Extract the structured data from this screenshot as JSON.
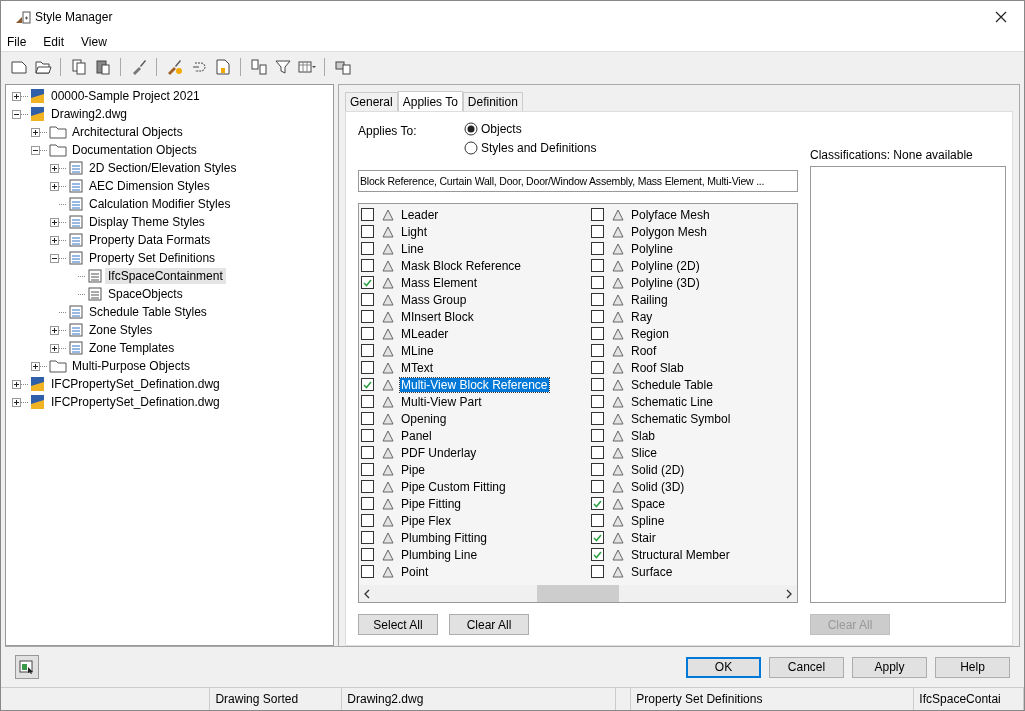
{
  "window": {
    "title": "Style Manager"
  },
  "menu": [
    "File",
    "Edit",
    "View"
  ],
  "tree": [
    {
      "label": "00000-Sample Project 2021",
      "expanded": false,
      "selected": false
    },
    {
      "label": "Drawing2.dwg",
      "expanded": true,
      "selected": false,
      "children": [
        {
          "label": "Architectural Objects",
          "expanded": false,
          "selected": false
        },
        {
          "label": "Documentation Objects",
          "expanded": true,
          "selected": false,
          "children": [
            {
              "label": "2D Section/Elevation Styles",
              "expanded": false,
              "selected": false
            },
            {
              "label": "AEC Dimension Styles",
              "expanded": false,
              "selected": false
            },
            {
              "label": "Calculation Modifier Styles",
              "selected": false
            },
            {
              "label": "Display Theme Styles",
              "expanded": false,
              "selected": false
            },
            {
              "label": "Property Data Formats",
              "expanded": false,
              "selected": false
            },
            {
              "label": "Property Set Definitions",
              "expanded": true,
              "selected": false,
              "children": [
                {
                  "label": "IfcSpaceContainment",
                  "selected": true
                },
                {
                  "label": "SpaceObjects",
                  "selected": false
                }
              ]
            },
            {
              "label": "Schedule Table Styles",
              "selected": false
            },
            {
              "label": "Zone Styles",
              "expanded": false,
              "selected": false
            },
            {
              "label": "Zone Templates",
              "expanded": false,
              "selected": false
            }
          ]
        },
        {
          "label": "Multi-Purpose Objects",
          "expanded": false,
          "selected": false
        }
      ]
    },
    {
      "label": "IFCPropertySet_Defination.dwg",
      "expanded": false,
      "selected": false
    },
    {
      "label": "IFCPropertySet_Defination.dwg",
      "expanded": false,
      "selected": false
    }
  ],
  "tabs": [
    {
      "label": "General",
      "selected": false
    },
    {
      "label": "Applies To",
      "selected": true
    },
    {
      "label": "Definition",
      "selected": false
    }
  ],
  "applies_to": {
    "label": "Applies To:",
    "options": [
      {
        "label": "Objects",
        "selected": true
      },
      {
        "label": "Styles and Definitions",
        "selected": false
      }
    ],
    "summary": "Block Reference, Curtain Wall, Door, Door/Window Assembly, Mass Element, Multi-View ...",
    "items": [
      {
        "label": "Leader",
        "checked": false,
        "selected": false
      },
      {
        "label": "Light",
        "checked": false,
        "selected": false
      },
      {
        "label": "Line",
        "checked": false,
        "selected": false
      },
      {
        "label": "Mask Block Reference",
        "checked": false,
        "selected": false
      },
      {
        "label": "Mass Element",
        "checked": true,
        "selected": false
      },
      {
        "label": "Mass Group",
        "checked": false,
        "selected": false
      },
      {
        "label": "MInsert Block",
        "checked": false,
        "selected": false
      },
      {
        "label": "MLeader",
        "checked": false,
        "selected": false
      },
      {
        "label": "MLine",
        "checked": false,
        "selected": false
      },
      {
        "label": "MText",
        "checked": false,
        "selected": false
      },
      {
        "label": "Multi-View Block Reference",
        "checked": true,
        "selected": true
      },
      {
        "label": "Multi-View Part",
        "checked": false,
        "selected": false
      },
      {
        "label": "Opening",
        "checked": false,
        "selected": false
      },
      {
        "label": "Panel",
        "checked": false,
        "selected": false
      },
      {
        "label": "PDF Underlay",
        "checked": false,
        "selected": false
      },
      {
        "label": "Pipe",
        "checked": false,
        "selected": false
      },
      {
        "label": "Pipe Custom Fitting",
        "checked": false,
        "selected": false
      },
      {
        "label": "Pipe Fitting",
        "checked": false,
        "selected": false
      },
      {
        "label": "Pipe Flex",
        "checked": false,
        "selected": false
      },
      {
        "label": "Plumbing Fitting",
        "checked": false,
        "selected": false
      },
      {
        "label": "Plumbing Line",
        "checked": false,
        "selected": false
      },
      {
        "label": "Point",
        "checked": false,
        "selected": false
      },
      {
        "label": "Polyface Mesh",
        "checked": false,
        "selected": false
      },
      {
        "label": "Polygon Mesh",
        "checked": false,
        "selected": false
      },
      {
        "label": "Polyline",
        "checked": false,
        "selected": false
      },
      {
        "label": "Polyline (2D)",
        "checked": false,
        "selected": false
      },
      {
        "label": "Polyline (3D)",
        "checked": false,
        "selected": false
      },
      {
        "label": "Railing",
        "checked": false,
        "selected": false
      },
      {
        "label": "Ray",
        "checked": false,
        "selected": false
      },
      {
        "label": "Region",
        "checked": false,
        "selected": false
      },
      {
        "label": "Roof",
        "checked": false,
        "selected": false
      },
      {
        "label": "Roof Slab",
        "checked": false,
        "selected": false
      },
      {
        "label": "Schedule Table",
        "checked": false,
        "selected": false
      },
      {
        "label": "Schematic Line",
        "checked": false,
        "selected": false
      },
      {
        "label": "Schematic Symbol",
        "checked": false,
        "selected": false
      },
      {
        "label": "Slab",
        "checked": false,
        "selected": false
      },
      {
        "label": "Slice",
        "checked": false,
        "selected": false
      },
      {
        "label": "Solid (2D)",
        "checked": false,
        "selected": false
      },
      {
        "label": "Solid (3D)",
        "checked": false,
        "selected": false
      },
      {
        "label": "Space",
        "checked": true,
        "selected": false
      },
      {
        "label": "Spline",
        "checked": false,
        "selected": false
      },
      {
        "label": "Stair",
        "checked": true,
        "selected": false
      },
      {
        "label": "Structural Member",
        "checked": true,
        "selected": false
      },
      {
        "label": "Surface",
        "checked": false,
        "selected": false
      }
    ],
    "buttons": [
      {
        "label": "Select All",
        "disabled": false
      },
      {
        "label": "Clear All",
        "disabled": false
      }
    ]
  },
  "classifications": {
    "label": "Classifications: None available",
    "button": {
      "label": "Clear All",
      "disabled": true
    }
  },
  "dialog_buttons": [
    {
      "label": "OK",
      "default": true
    },
    {
      "label": "Cancel",
      "default": false
    },
    {
      "label": "Apply",
      "default": false
    },
    {
      "label": "Help",
      "default": false
    }
  ],
  "status_bar": [
    "Drawing Sorted",
    "Drawing2.dwg",
    "Property Set Definitions",
    "IfcSpaceContai"
  ]
}
